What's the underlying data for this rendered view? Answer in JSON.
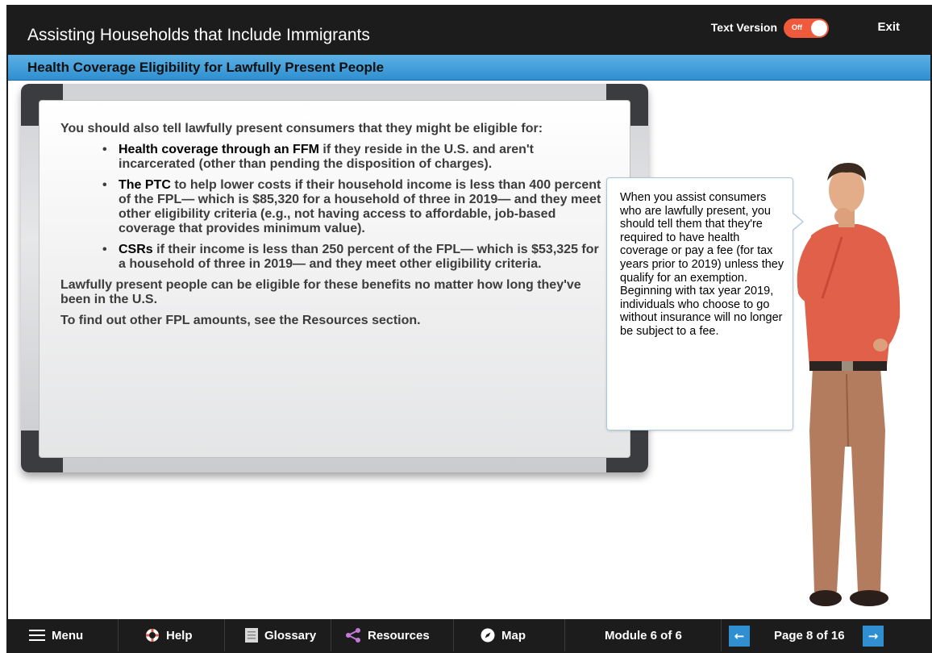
{
  "header": {
    "app_title": "Assisting Households that Include Immigrants",
    "text_version_label": "Text Version",
    "toggle_state": "Off",
    "exit_label": "Exit",
    "page_title": "Health Coverage Eligibility for Lawfully Present People"
  },
  "board": {
    "intro": "You should also tell lawfully present consumers that they might be eligible for:",
    "bullets": [
      {
        "bold": "Health coverage through an FFM",
        "rest": " if they reside in the U.S. and aren't incarcerated (other than pending the disposition of charges)."
      },
      {
        "bold": "The PTC",
        "rest": " to help lower costs if their household income is less than 400 percent of the FPL— which is $85,320 for a household of three in 2019— and they meet other eligibility criteria (e.g., not having access to affordable, job-based coverage that provides minimum value)."
      },
      {
        "bold": "CSRs",
        "rest": " if their income is less than 250 percent of the FPL— which is $53,325 for a household of three in 2019— and they meet other eligibility criteria."
      }
    ],
    "para1": "Lawfully present people can be eligible for these benefits no matter how long they've been in the U.S.",
    "para2": "To find out other FPL amounts, see the Resources section."
  },
  "bubble": {
    "text": "When you assist consumers who are lawfully present, you should tell them that they're required to have health coverage or pay a fee (for tax years prior to 2019) unless they qualify for an exemption. Beginning with tax year 2019, individuals who choose to go without insurance will no longer be subject to a fee."
  },
  "footer": {
    "menu": "Menu",
    "help": "Help",
    "glossary": "Glossary",
    "resources": "Resources",
    "map": "Map",
    "module": "Module 6 of 6",
    "page": "Page 8 of 16",
    "prev_icon": "arrow-left-icon",
    "next_icon": "arrow-right-icon"
  },
  "colors": {
    "bar": "#1c1c1c",
    "accent_blue": "#2f8fd0",
    "toggle": "#f05a3c",
    "shirt": "#e0604a",
    "pants": "#b47c5e"
  }
}
